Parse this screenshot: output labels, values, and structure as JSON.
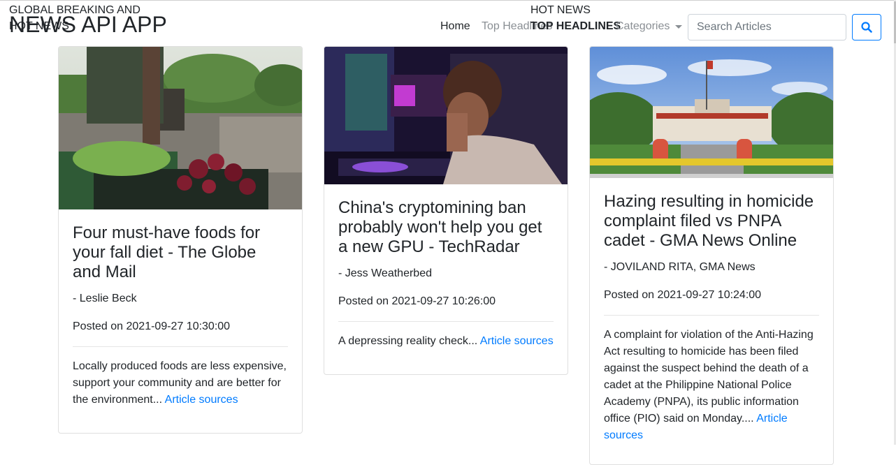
{
  "header": {
    "brand_line1": "GLOBAL BREAKING AND",
    "brand_line1b": "HOT NEWS",
    "brand_line2": "NEWS API APP",
    "hot_news": "HOT NEWS",
    "top_headlines_banner": "TOP HEADLINES",
    "nav": {
      "home": "Home",
      "top_headlines": "Top Headlines",
      "categories": "Categories"
    },
    "search_placeholder": "Search Articles"
  },
  "cards": [
    {
      "title": "Four must-have foods for your fall diet - The Globe and Mail",
      "author": "- Leslie Beck",
      "posted": "Posted on 2021-09-27 10:30:00",
      "description": "Locally produced foods are less expensive, support your community and are better for the environment...",
      "link_text": "Article sources"
    },
    {
      "title": "China's cryptomining ban probably won't help you get a new GPU - TechRadar",
      "author": "- Jess Weatherbed",
      "posted": "Posted on 2021-09-27 10:26:00",
      "description": "A depressing reality check...",
      "link_text": "Article sources"
    },
    {
      "title": "Hazing resulting in homicide complaint filed vs PNPA cadet - GMA News Online",
      "author": "- JOVILAND RITA, GMA News",
      "posted": "Posted on 2021-09-27 10:24:00",
      "description": "A complaint for violation of the Anti-Hazing Act resulting to homicide has been filed against the suspect behind the death of a cadet at the Philippine National Police Academy (PNPA), its public information office (PIO) said on Monday....",
      "link_text": "Article sources"
    }
  ],
  "colors": {
    "link": "#007bff",
    "text": "#212529",
    "muted_nav": "#8a8f94"
  },
  "icons": {
    "search_button": "search-icon",
    "categories_toggle": "caret-down-icon"
  }
}
